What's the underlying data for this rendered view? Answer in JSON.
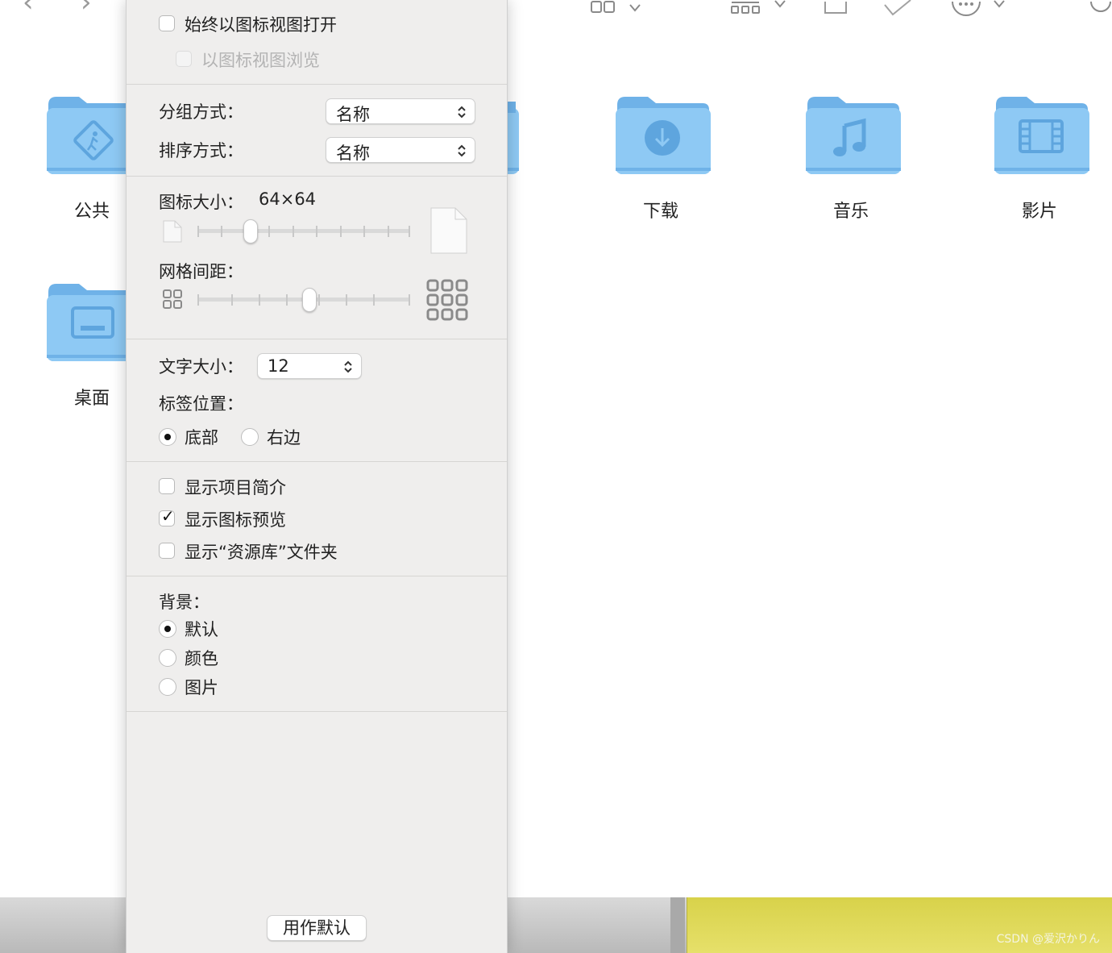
{
  "finder": {
    "folders": [
      {
        "label": "公共",
        "icon": "walking-person-icon"
      },
      {
        "label": "桌面",
        "icon": "desktop-icon"
      },
      {
        "label": "下载",
        "icon": "download-arrow-icon"
      },
      {
        "label": "音乐",
        "icon": "music-note-icon"
      },
      {
        "label": "影片",
        "icon": "film-icon"
      }
    ],
    "watermark": "CSDN @爱沢かりん",
    "folder_color": "#8ec9f4"
  },
  "panel": {
    "always_open_icon_view": "始终以图标视图打开",
    "browse_icon_view": "以图标视图浏览",
    "group_by_label": "分组方式：",
    "group_by_value": "名称",
    "sort_by_label": "排序方式：",
    "sort_by_value": "名称",
    "icon_size_label": "图标大小：",
    "icon_size_value": "64×64",
    "icon_size_level": 0.23,
    "grid_spacing_label": "网格间距：",
    "grid_spacing_level": 0.53,
    "text_size_label": "文字大小：",
    "text_size_value": "12",
    "label_position_label": "标签位置：",
    "label_position_options": [
      "底部",
      "右边"
    ],
    "label_position_selected": "底部",
    "show_item_info": "显示项目简介",
    "show_icon_preview": "显示图标预览",
    "show_library_folder": "显示“资源库”文件夹",
    "checks": {
      "always_open": false,
      "browse": false,
      "item_info": false,
      "icon_preview": true,
      "library": false
    },
    "background_label": "背景：",
    "background_options": [
      "默认",
      "颜色",
      "图片"
    ],
    "background_selected": "默认",
    "use_as_default": "用作默认"
  }
}
